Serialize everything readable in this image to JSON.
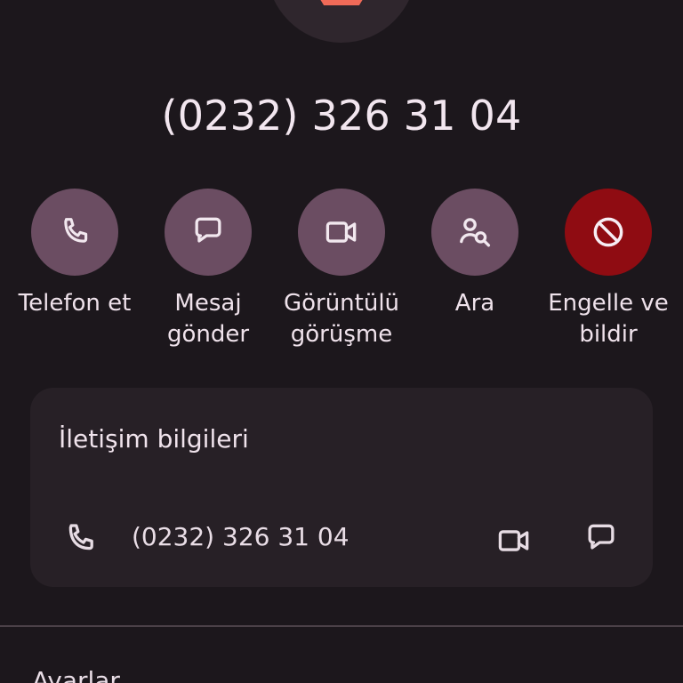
{
  "header": {
    "phone_number": "(0232) 326 31 04"
  },
  "actions": [
    {
      "label": "Telefon et",
      "icon": "phone-icon"
    },
    {
      "label": "Mesaj\ngönder",
      "icon": "message-icon"
    },
    {
      "label": "Görüntülü\ngörüşme",
      "icon": "video-icon"
    },
    {
      "label": "Ara",
      "icon": "search-user-icon"
    },
    {
      "label": "Engelle ve\nbildir",
      "icon": "block-icon"
    }
  ],
  "contact_info": {
    "title": "İletişim bilgileri",
    "number": "(0232) 326 31 04"
  },
  "settings": {
    "title": "Ayarlar"
  },
  "colors": {
    "background": "#1c171c",
    "surface": "#272026",
    "accent": "#6b4d62",
    "block": "#8f0c12",
    "stop": "#f06a58"
  }
}
